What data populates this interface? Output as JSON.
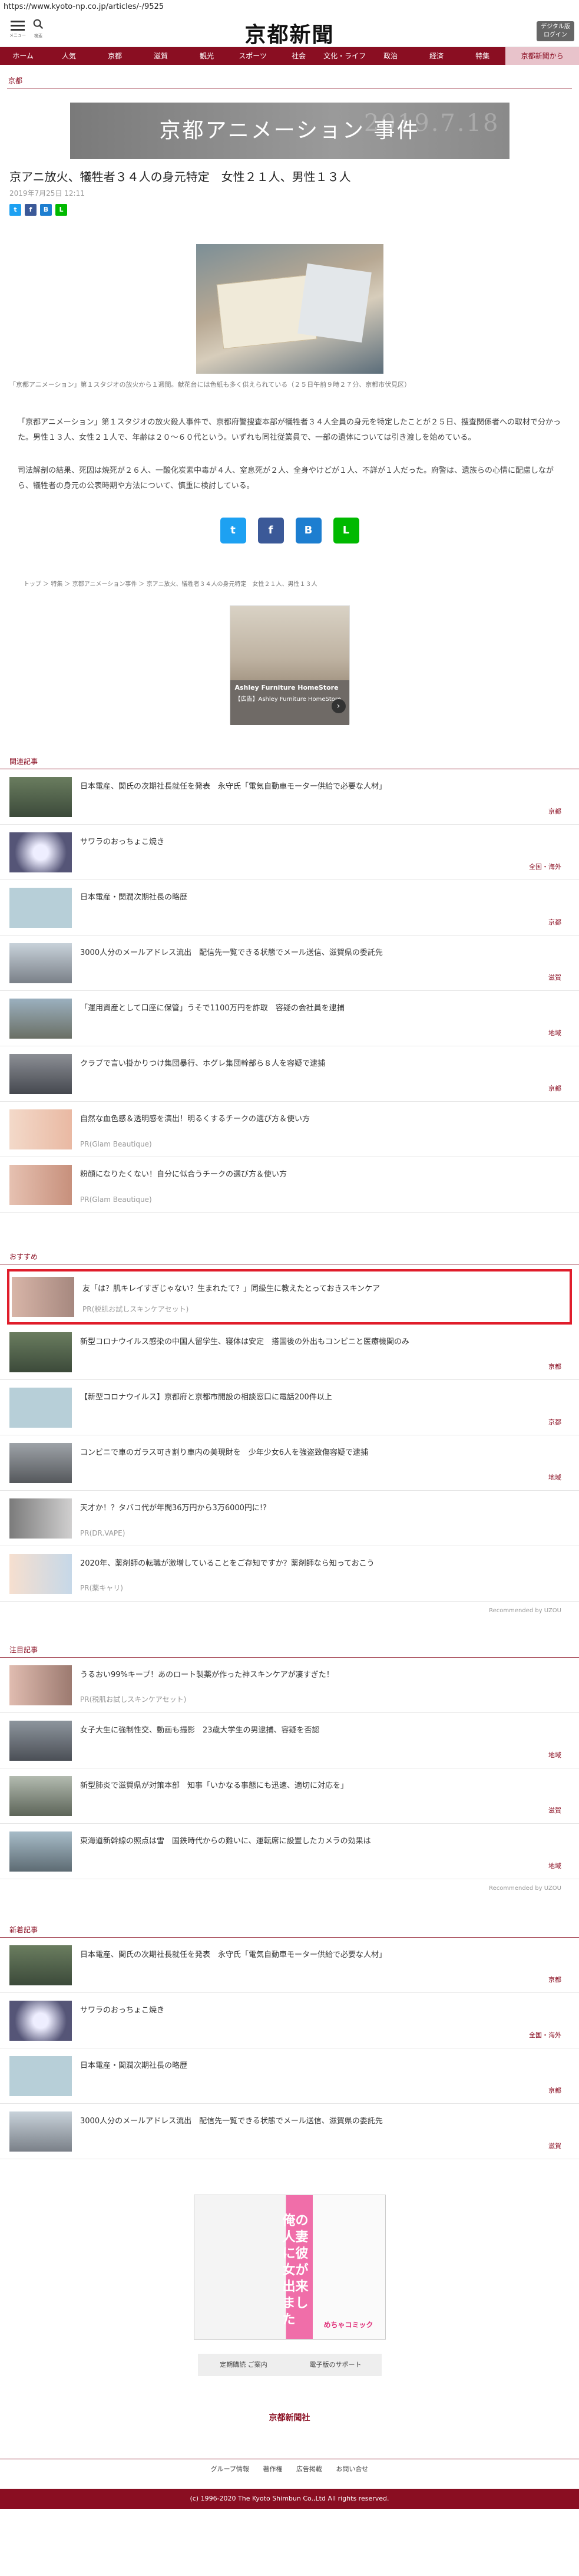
{
  "url": "https://www.kyoto-np.co.jp/articles/-/9525",
  "header": {
    "menu_label": "メニュー",
    "search_label": "検索",
    "logo": "京都新聞",
    "reader_button": "デジタル版\nログイン"
  },
  "nav": [
    "ホーム",
    "人気",
    "京都",
    "滋賀",
    "観光",
    "スポーツ",
    "社会",
    "文化・ライフ",
    "政治",
    "経済",
    "特集",
    "京都新聞から"
  ],
  "category": "京都",
  "banner": {
    "text": "京都アニメーション 事件",
    "date": "2019.7.18"
  },
  "article": {
    "title": "京アニ放火、犠牲者３４人の身元特定　女性２１人、男性１３人",
    "date": "2019年7月25日 12:11",
    "caption": "「京都アニメーション」第１スタジオの放火から１週間。献花台には色紙も多く供えられている（２５日午前９時２７分、京都市伏見区）",
    "para1": "「京都アニメーション」第１スタジオの放火殺人事件で、京都府警捜査本部が犠牲者３４人全員の身元を特定したことが２５日、捜査関係者への取材で分かった。男性１３人、女性２１人で、年齢は２０～６０代という。いずれも同社従業員で、一部の遺体については引き渡しを始めている。",
    "para2": "司法解剖の結果、死因は焼死が２６人、一酸化炭素中毒が４人、窒息死が２人、全身やけどが１人、不詳が１人だった。府警は、遺族らの心情に配慮しながら、犠牲者の身元の公表時期や方法について、慎重に検討している。"
  },
  "breadcrumb": [
    "トップ",
    "特集",
    "京都アニメーション事件",
    "京アニ放火、犠牲者３４人の身元特定　女性２１人、男性１３人"
  ],
  "ad1": {
    "brand": "Ashley Furniture HomeStore",
    "sub": "【広告】Ashley Furniture HomeStore"
  },
  "related": {
    "heading": "関連記事",
    "items": [
      {
        "title": "日本電産、関氏の次期社長就任を発表　永守氏「電気自動車モーター供給で必要な人材」",
        "tag": "京都"
      },
      {
        "title": "サワラのおっちょこ焼き",
        "tag": "全国・海外"
      },
      {
        "title": "日本電産・関潤次期社長の略歴",
        "tag": "京都"
      },
      {
        "title": "3000人分のメールアドレス流出　配信先一覧できる状態でメール送信、滋賀県の委託先",
        "tag": "滋賀"
      },
      {
        "title": "「運用資産として口座に保管」うそで1100万円を詐取　容疑の会社員を逮捕",
        "tag": "地域"
      },
      {
        "title": "クラブで言い掛かりつけ集団暴行、ホグレ集団幹部ら８人を容疑で逮捕",
        "tag": "京都"
      },
      {
        "title": "自然な血色感＆透明感を演出！明るくするチークの選び方＆使い方",
        "pr": "PR(Glam Beautique)"
      },
      {
        "title": "粉顔になりたくない！自分に似合うチークの選び方＆使い方",
        "pr": "PR(Glam Beautique)"
      }
    ]
  },
  "recommend": {
    "heading": "おすすめ",
    "items": [
      {
        "title": "友「は？肌キレイすぎじゃない？生まれたて？」同級生に教えたとっておきスキンケア",
        "pr": "PR(税肌お試しスキンケアセット)"
      },
      {
        "title": "新型コロナウイルス感染の中国人留学生、寝体は安定　搭国後の外出もコンビニと医療機関のみ",
        "tag": "京都"
      },
      {
        "title": "【新型コロナウイルス】京都府と京都市開設の相談窓口に電話200件以上",
        "tag": "京都"
      },
      {
        "title": "コンビニで車のガラス可き割り車内の美現財を　少年少女6人を強盗致傷容疑で逮捕",
        "tag": "地域"
      },
      {
        "title": "天才か！？タバコ代が年間36万円から3万6000円に!?",
        "pr": "PR(DR.VAPE)"
      },
      {
        "title": "2020年、薬剤師の転職が激増していることをご存知ですか？薬剤師なら知っておこう",
        "pr": "PR(薬キャリ)"
      }
    ],
    "recommended_by": "Recommended by UZOU"
  },
  "attention": {
    "heading": "注目記事",
    "items": [
      {
        "title": "うるおい99%キープ！あのロート製薬が作った神スキンケアが凄すぎた！",
        "pr": "PR(税肌お試しスキンケアセット)"
      },
      {
        "title": "女子大生に強制性交、動画も撮影　23歳大学生の男逮捕、容疑を否認",
        "tag": "地域"
      },
      {
        "title": "新型肺炎で滋賀県が対策本部　知事「いかなる事態にも迅速、適切に対応を」",
        "tag": "滋賀"
      },
      {
        "title": "東海道新幹線の照点は雪　国鉄時代からの難いに、運転席に設置したカメラの効果は",
        "tag": "地域"
      }
    ],
    "recommended_by": "Recommended by UZOU"
  },
  "latest": {
    "heading": "新着記事",
    "items": [
      {
        "title": "日本電産、関氏の次期社長就任を発表　永守氏「電気自動車モーター供給で必要な人材」",
        "tag": "京都"
      },
      {
        "title": "サワラのおっちょこ焼き",
        "tag": "全国・海外"
      },
      {
        "title": "日本電産・関潤次期社長の略歴",
        "tag": "京都"
      },
      {
        "title": "3000人分のメールアドレス流出　配信先一覧できる状態でメール送信、滋賀県の委託先",
        "tag": "滋賀"
      }
    ]
  },
  "footer_ad": {
    "text": "俺の人妻に彼女が出来ました",
    "brand": "めちゃコミック"
  },
  "footer_buttons": [
    "定期購読 ご案内",
    "電子版のサポート"
  ],
  "footer_logo": "京都新聞社",
  "footer_nav": [
    "グループ情報",
    "著作権",
    "広告掲載",
    "お問い合せ"
  ],
  "copyright": "(c) 1996-2020 The Kyoto Shimbun Co.,Ltd All rights reserved.",
  "colors": {
    "brand": "#8a0e22",
    "highlight": "#e01d2b"
  }
}
